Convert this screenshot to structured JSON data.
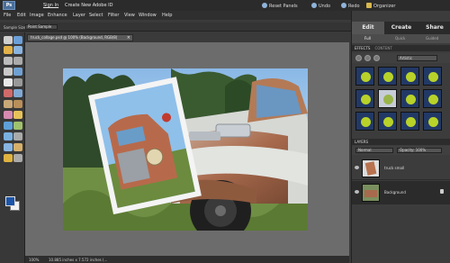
{
  "header": {
    "logo": "Ps",
    "sign_in": "Sign In",
    "create_id": "Create New Adobe ID",
    "tools": [
      {
        "label": "Reset Panels",
        "icon": "reset-icon"
      },
      {
        "label": "Undo",
        "icon": "undo-icon"
      },
      {
        "label": "Redo",
        "icon": "redo-icon"
      },
      {
        "label": "Organizer",
        "icon": "organizer-icon"
      }
    ]
  },
  "menu": [
    "File",
    "Edit",
    "Image",
    "Enhance",
    "Layer",
    "Select",
    "Filter",
    "View",
    "Window",
    "Help"
  ],
  "options": {
    "label": "Sample Size:",
    "value": "Point Sample"
  },
  "document": {
    "tab_title": "truck_collage.psd @ 100% (Background, RGB/8)"
  },
  "status": {
    "zoom": "100%",
    "size": "10.885 inches x 7.572 inches (..."
  },
  "panel": {
    "mode_tabs": [
      "Edit",
      "Create",
      "Share"
    ],
    "sub_tabs": [
      "Full",
      "Quick",
      "Guided"
    ],
    "effects_header": "EFFECTS",
    "effects_extra": "CONTENT",
    "effects_filter": "Artistic",
    "layers_header": "LAYERS",
    "layers_blend": "Normal",
    "layers_opacity": "Opacity: 100%",
    "layers": [
      {
        "name": "truck small"
      },
      {
        "name": "Background"
      }
    ]
  },
  "colors": {
    "foreground": "#1d55a8",
    "background": "#f2f2f2",
    "effect_ball": "#b8d22a"
  }
}
